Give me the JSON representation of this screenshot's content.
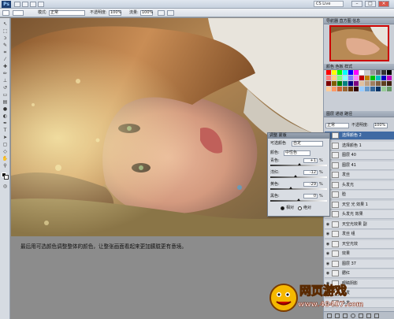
{
  "app": {
    "logo_text": "Ps",
    "cs_live": "CS Live"
  },
  "options_bar": {
    "mode_label": "模式:",
    "mode_value": "正常",
    "opacity_label": "不透明度:",
    "opacity_value": "100%",
    "flow_label": "流量:",
    "flow_value": "100%"
  },
  "navigator": {
    "tab": "导航器  直方图  信息"
  },
  "swatches": {
    "tab": "颜色  色板  样式"
  },
  "layers": {
    "tab": "图层  通道  路径",
    "blend_mode": "正常",
    "opacity_label": "不透明度:",
    "opacity_value": "100%",
    "items": [
      {
        "name": "选择颜色 2",
        "selected": true
      },
      {
        "name": "选择颜色 1",
        "selected": false
      },
      {
        "name": "图层 40",
        "selected": false
      },
      {
        "name": "图层 41",
        "selected": false
      },
      {
        "name": "发丝",
        "selected": false
      },
      {
        "name": "头发光",
        "selected": false
      },
      {
        "name": "脸",
        "selected": false
      },
      {
        "name": "天空 光 效果 1",
        "selected": false
      },
      {
        "name": "头发光 效果",
        "selected": false
      },
      {
        "name": "天空光效果 副",
        "selected": false
      },
      {
        "name": "发丝 组",
        "selected": false
      },
      {
        "name": "天空光效",
        "selected": false
      },
      {
        "name": "效果",
        "selected": false
      },
      {
        "name": "图层 37",
        "selected": false
      },
      {
        "name": "腮红",
        "selected": false
      },
      {
        "name": "眼睛阴影",
        "selected": false
      },
      {
        "name": "头发",
        "selected": false
      },
      {
        "name": "头发",
        "selected": false
      }
    ]
  },
  "adjustments": {
    "title": "调整  蒙版",
    "preset_label": "可选颜色",
    "preset_value": "自定",
    "colors_label": "颜色:",
    "colors_value": "中性色",
    "rows": [
      {
        "label": "青色:",
        "value": "+1",
        "pct": "%",
        "level": 0.51
      },
      {
        "label": "洋红:",
        "value": "-12",
        "pct": "%",
        "level": 0.44
      },
      {
        "label": "黄色:",
        "value": "-29",
        "pct": "%",
        "level": 0.36
      },
      {
        "label": "黑色:",
        "value": "0",
        "pct": "%",
        "level": 0.5
      }
    ],
    "relative_label": "相对",
    "absolute_label": "绝对"
  },
  "caption": "最后用可选颜色调整整体的颜色，让整张画面看起来更加朦胧更有意境。",
  "watermark": {
    "line1": "网页游戏",
    "line2": "www.40407.com"
  },
  "colors": {
    "accent": "#3f6aa3",
    "background": "#8c8c8c",
    "nav_frame": "#cc0000"
  }
}
